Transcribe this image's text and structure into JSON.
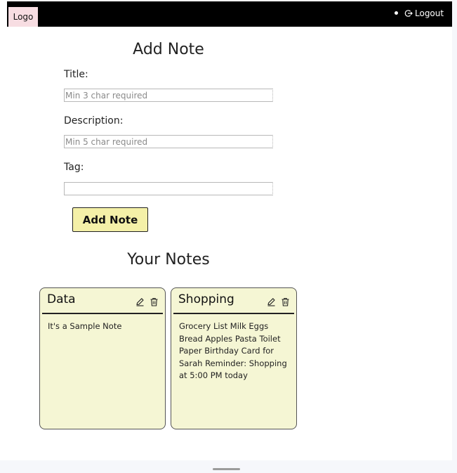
{
  "navbar": {
    "logo_label": "Logo",
    "logout_label": "Logout",
    "logout_icon": "logout-icon"
  },
  "add_form": {
    "heading": "Add Note",
    "title_label": "Title:",
    "title_value": "",
    "title_placeholder": "Min 3 char required",
    "description_label": "Description:",
    "description_value": "",
    "description_placeholder": "Min 5 char required",
    "tag_label": "Tag:",
    "tag_value": "",
    "tag_placeholder": "",
    "submit_label": "Add Note"
  },
  "notes_section": {
    "heading": "Your Notes",
    "notes": [
      {
        "title": "Data",
        "description": "It's a Sample Note",
        "edit_icon": "edit-icon",
        "delete_icon": "trash-icon"
      },
      {
        "title": "Shopping",
        "description": "Grocery List Milk Eggs Bread Apples Pasta Toilet Paper Birthday Card for Sarah Reminder: Shopping at 5:00 PM today",
        "edit_icon": "edit-icon",
        "delete_icon": "trash-icon"
      }
    ]
  },
  "colors": {
    "navbar_bg": "#000000",
    "logo_bg": "#f7dde2",
    "button_bg": "#f4f0a8",
    "note_bg": "#f5f6d4"
  }
}
